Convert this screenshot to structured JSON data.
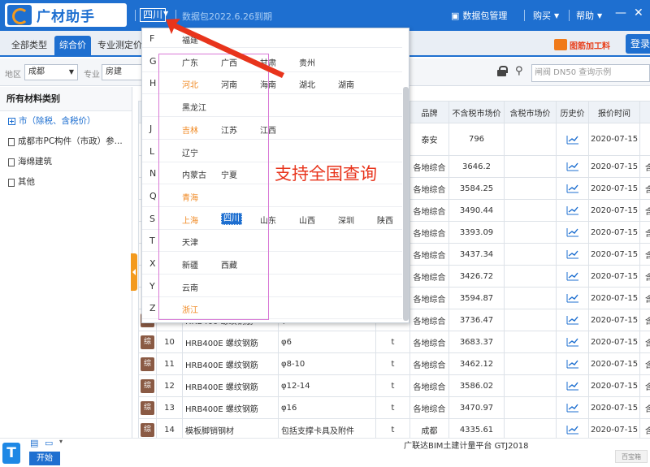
{
  "app": {
    "title": "广材助手",
    "province": "四川",
    "expire": "数据包2022.6.26到期",
    "data_pkg_label": "数据包管理",
    "buy_label": "购买",
    "help_label": "帮助"
  },
  "tabs": [
    {
      "label": "全部类型"
    },
    {
      "label": "综合价"
    },
    {
      "label": "专业测定价"
    }
  ],
  "promo": {
    "label": "图筋加工料",
    "login": "登录"
  },
  "filters": {
    "region_label": "地区",
    "region_value": "成都",
    "major_label": "专业",
    "major_value": "房建",
    "search_placeholder": "闸阀 DN50 查询示例"
  },
  "left_panel": {
    "header": "所有材料类别",
    "items": [
      {
        "label": "市（除税、含税价）"
      },
      {
        "label": "成都市PC构件（市政）参..."
      },
      {
        "label": "海绵建筑"
      },
      {
        "label": "其他"
      }
    ]
  },
  "table": {
    "headers": [
      "",
      "",
      "",
      "",
      "",
      "品牌",
      "不含税市场价",
      "含税市场价",
      "历史价",
      "报价时间",
      ""
    ],
    "rows": [
      {
        "badge": "",
        "no": "",
        "name": "",
        "spec": "",
        "unit": "",
        "brand": "泰安",
        "price": "796",
        "tax_price": "",
        "date": "2020-07-15",
        "extra": ""
      },
      {
        "badge": "",
        "no": "",
        "name": "",
        "spec": "",
        "unit": "",
        "brand": "各地综合",
        "price": "3646.2",
        "tax_price": "",
        "date": "2020-07-15",
        "extra": "含"
      },
      {
        "badge": "",
        "no": "",
        "name": "",
        "spec": "",
        "unit": "",
        "brand": "各地综合",
        "price": "3584.25",
        "tax_price": "",
        "date": "2020-07-15",
        "extra": "含"
      },
      {
        "badge": "",
        "no": "",
        "name": "",
        "spec": "",
        "unit": "",
        "brand": "各地综合",
        "price": "3490.44",
        "tax_price": "",
        "date": "2020-07-15",
        "extra": "含"
      },
      {
        "badge": "",
        "no": "",
        "name": "",
        "spec": "",
        "unit": "",
        "brand": "各地综合",
        "price": "3393.09",
        "tax_price": "",
        "date": "2020-07-15",
        "extra": "含"
      },
      {
        "badge": "",
        "no": "",
        "name": "",
        "spec": "",
        "unit": "",
        "brand": "各地综合",
        "price": "3437.34",
        "tax_price": "",
        "date": "2020-07-15",
        "extra": "含"
      },
      {
        "badge": "",
        "no": "",
        "name": "",
        "spec": "",
        "unit": "",
        "brand": "各地综合",
        "price": "3426.72",
        "tax_price": "",
        "date": "2020-07-15",
        "extra": "含"
      },
      {
        "badge": "",
        "no": "",
        "name": "",
        "spec": "",
        "unit": "",
        "brand": "各地综合",
        "price": "3594.87",
        "tax_price": "",
        "date": "2020-07-15",
        "extra": "含"
      },
      {
        "badge": "综",
        "no": "9",
        "name": "HRB400 螺纹钢筋",
        "spec": "φ36-40",
        "unit": "t",
        "brand": "各地综合",
        "price": "3736.47",
        "tax_price": "",
        "date": "2020-07-15",
        "extra": "含"
      },
      {
        "badge": "综",
        "no": "10",
        "name": "HRB400E 螺纹钢筋",
        "spec": "φ6",
        "unit": "t",
        "brand": "各地综合",
        "price": "3683.37",
        "tax_price": "",
        "date": "2020-07-15",
        "extra": "含"
      },
      {
        "badge": "综",
        "no": "11",
        "name": "HRB400E 螺纹钢筋",
        "spec": "φ8-10",
        "unit": "t",
        "brand": "各地综合",
        "price": "3462.12",
        "tax_price": "",
        "date": "2020-07-15",
        "extra": "含"
      },
      {
        "badge": "综",
        "no": "12",
        "name": "HRB400E 螺纹钢筋",
        "spec": "φ12-14",
        "unit": "t",
        "brand": "各地综合",
        "price": "3586.02",
        "tax_price": "",
        "date": "2020-07-15",
        "extra": "含"
      },
      {
        "badge": "综",
        "no": "13",
        "name": "HRB400E 螺纹钢筋",
        "spec": "φ16",
        "unit": "t",
        "brand": "各地综合",
        "price": "3470.97",
        "tax_price": "",
        "date": "2020-07-15",
        "extra": "含"
      },
      {
        "badge": "综",
        "no": "14",
        "name": "模板脚销钢材",
        "spec": "包括支撑卡具及附件",
        "unit": "t",
        "brand": "成都",
        "price": "4335.61",
        "tax_price": "",
        "date": "2020-07-15",
        "extra": "含"
      }
    ]
  },
  "province_dropdown": {
    "rows": [
      {
        "letter": "F",
        "provinces": [
          "福建"
        ]
      },
      {
        "letter": "G",
        "provinces": [
          "广东",
          "广西",
          "甘肃",
          "贵州"
        ]
      },
      {
        "letter": "H",
        "provinces": [
          "河北",
          "河南",
          "海南",
          "湖北",
          "湖南"
        ]
      },
      {
        "letter": "",
        "provinces": [
          "黑龙江"
        ]
      },
      {
        "letter": "J",
        "provinces": [
          "吉林",
          "江苏",
          "江西"
        ]
      },
      {
        "letter": "L",
        "provinces": [
          "辽宁"
        ]
      },
      {
        "letter": "N",
        "provinces": [
          "内蒙古",
          "宁夏"
        ]
      },
      {
        "letter": "Q",
        "provinces": [
          "青海"
        ]
      },
      {
        "letter": "S",
        "provinces": [
          "上海",
          "四川",
          "山东",
          "山西",
          "深圳",
          "陕西"
        ]
      },
      {
        "letter": "T",
        "provinces": [
          "天津"
        ]
      },
      {
        "letter": "X",
        "provinces": [
          "新疆",
          "西藏"
        ]
      },
      {
        "letter": "Y",
        "provinces": [
          "云南"
        ]
      },
      {
        "letter": "Z",
        "provinces": [
          "浙江"
        ]
      }
    ],
    "hot_color": "#f08a24"
  },
  "annotation": {
    "text": "支持全国查询",
    "color": "#e8341c"
  },
  "bottom": {
    "taskbar_logo": "T",
    "start": "开始",
    "software": "广联达BIM土建计量平台 GTJ2018",
    "corner": "百宝箱"
  },
  "colors": {
    "primary": "#1e6fd0",
    "accent": "#f39a1e"
  }
}
